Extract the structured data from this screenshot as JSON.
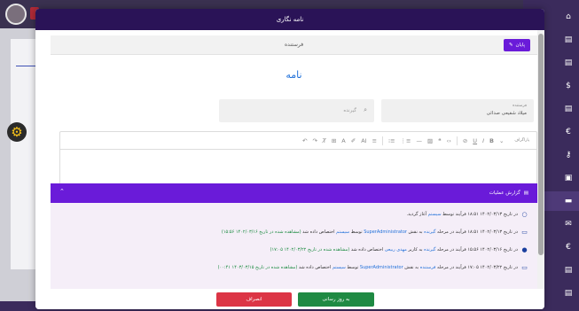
{
  "modal": {
    "title": "نامه نگاری",
    "sender_section_label": "فرستنده",
    "end_button_label": "پایان",
    "letter_title": "نامه"
  },
  "sender_field": {
    "label": "فرستنده",
    "value": "میلاد شفیعی صدائی"
  },
  "recipient_field": {
    "placeholder": "گیرنده"
  },
  "editor": {
    "paragraph_label": "پاراگراف"
  },
  "report": {
    "title": "گزارش عملیات",
    "rows": [
      {
        "icon": "circle-icon",
        "parts": [
          {
            "t": "در تاریخ ",
            "c": ""
          },
          {
            "t": "۱۴۰۲/۰۳/۱۳ ۱۸:۵۱",
            "c": ""
          },
          {
            "t": " فرآیند توسط ",
            "c": ""
          },
          {
            "t": "سیستم",
            "c": "blue"
          },
          {
            "t": " آغاز گردید.",
            "c": ""
          }
        ]
      },
      {
        "icon": "monitor-icon",
        "parts": [
          {
            "t": "در تاریخ ",
            "c": ""
          },
          {
            "t": "۱۴۰۲/۰۳/۱۳ ۱۸:۵۱",
            "c": ""
          },
          {
            "t": " فرآیند در مرحله ",
            "c": ""
          },
          {
            "t": "گیرنده",
            "c": "blue"
          },
          {
            "t": " به نقش ",
            "c": ""
          },
          {
            "t": "SuperAdministrator",
            "c": "blue"
          },
          {
            "t": " توسط ",
            "c": ""
          },
          {
            "t": "سیستم",
            "c": "blue"
          },
          {
            "t": " اختصاص داده شد ",
            "c": ""
          },
          {
            "t": "(مشاهده شده در تاریخ ۱۴۰۲/۰۳/۱۶ ۱۵:۵۶)",
            "c": "green"
          }
        ]
      },
      {
        "icon": "user-icon",
        "parts": [
          {
            "t": "در تاریخ ",
            "c": ""
          },
          {
            "t": "۱۴۰۲/۰۳/۱۶ ۱۵:۵۶",
            "c": ""
          },
          {
            "t": " فرآیند در مرحله ",
            "c": ""
          },
          {
            "t": "گیرنده",
            "c": "blue"
          },
          {
            "t": " به کاربر ",
            "c": ""
          },
          {
            "t": "مهدی ربیعی",
            "c": "blue"
          },
          {
            "t": " اختصاص داده شد ",
            "c": ""
          },
          {
            "t": "(مشاهده شده در تاریخ ۱۴۰۲/۰۳/۲۲ ۱۷:۰۵)",
            "c": "green"
          }
        ]
      },
      {
        "icon": "monitor-icon",
        "parts": [
          {
            "t": "در تاریخ ",
            "c": ""
          },
          {
            "t": "۱۴۰۲/۰۳/۲۲ ۱۷:۰۵",
            "c": ""
          },
          {
            "t": " فرآیند در مرحله ",
            "c": ""
          },
          {
            "t": "فرستنده",
            "c": "blue"
          },
          {
            "t": " به نقش ",
            "c": ""
          },
          {
            "t": "SuperAdministrator",
            "c": "blue"
          },
          {
            "t": " توسط ",
            "c": ""
          },
          {
            "t": "سیستم",
            "c": "blue"
          },
          {
            "t": " اختصاص داده شد ",
            "c": ""
          },
          {
            "t": "(مشاهده شده در تاریخ ۱۴۰۳/۰۳/۱۵ ۰۰:۴۱)",
            "c": "green"
          }
        ]
      }
    ]
  },
  "footer": {
    "cancel_label": "انصراف",
    "update_label": "به روز رسانی"
  },
  "colors": {
    "header_bg": "#2a1357",
    "accent_purple": "#6a1bd9",
    "link_blue": "#1e6fd9",
    "seen_green": "#1a8a3f",
    "cancel_red": "#dc3545",
    "update_green": "#1f8a43"
  }
}
